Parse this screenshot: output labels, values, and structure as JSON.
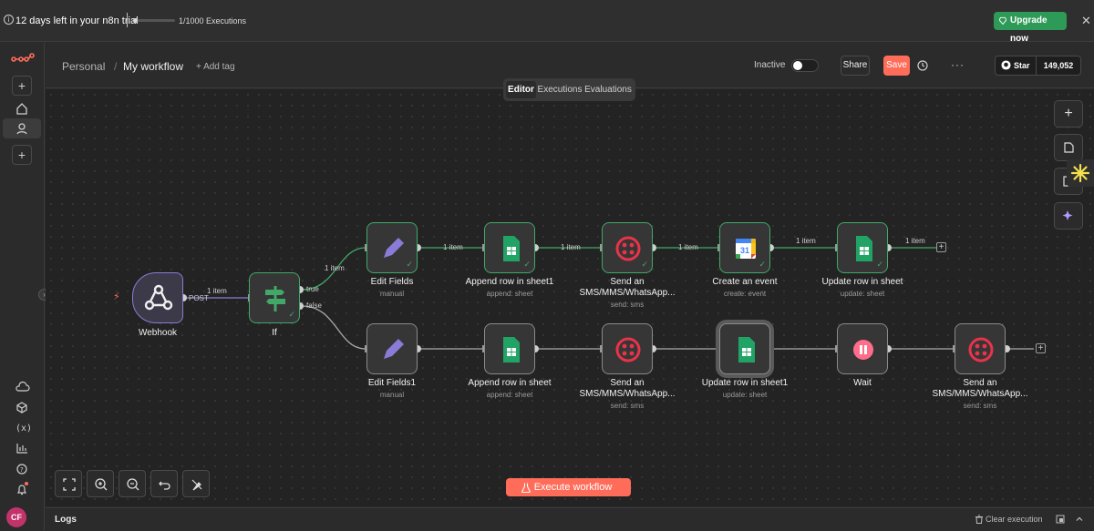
{
  "trial": {
    "text": "12 days left in your n8n trial",
    "executions": "1/1000 Executions",
    "upgrade_label": "Upgrade now"
  },
  "header": {
    "breadcrumb_project": "Personal",
    "workflow_name": "My workflow",
    "add_tag": "+ Add tag",
    "status_label": "Inactive",
    "share_label": "Share",
    "save_label": "Save",
    "more_label": "···",
    "github_star_label": "Star",
    "github_star_count": "149,052"
  },
  "tabs": [
    "Editor",
    "Executions",
    "Evaluations"
  ],
  "sidebar": {
    "avatar_initials": "CF"
  },
  "nodes": {
    "webhook": {
      "title": "Webhook",
      "port_label": "POST"
    },
    "if": {
      "title": "If",
      "true_label": "true",
      "false_label": "false"
    },
    "edit_fields": {
      "title": "Edit Fields",
      "sub": "manual"
    },
    "append_row1": {
      "title": "Append row in sheet1",
      "sub": "append: sheet"
    },
    "send_sms_top": {
      "title": "Send an SMS/MMS/WhatsApp...",
      "sub": "send: sms"
    },
    "create_event": {
      "title": "Create an event",
      "sub": "create: event"
    },
    "update_row": {
      "title": "Update row in sheet",
      "sub": "update: sheet"
    },
    "edit_fields1": {
      "title": "Edit Fields1",
      "sub": "manual"
    },
    "append_row": {
      "title": "Append row in sheet",
      "sub": "append: sheet"
    },
    "send_sms_mid": {
      "title": "Send an SMS/MMS/WhatsApp...",
      "sub": "send: sms"
    },
    "update_row1": {
      "title": "Update row in sheet1",
      "sub": "update: sheet"
    },
    "wait": {
      "title": "Wait"
    },
    "send_sms_end": {
      "title": "Send an SMS/MMS/WhatsApp...",
      "sub": "send: sms"
    }
  },
  "wire_labels": {
    "item": "1 item"
  },
  "footer": {
    "execute_label": "Execute workflow",
    "logs_label": "Logs",
    "clear_label": "Clear execution"
  },
  "colors": {
    "accent": "#ff6d5a",
    "success": "#41a86a",
    "upgrade": "#2e9a57",
    "trigger": "#8b7bd8"
  }
}
